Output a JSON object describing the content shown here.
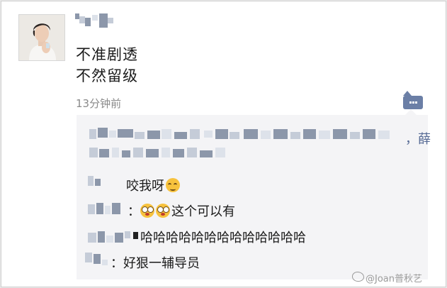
{
  "post": {
    "lines": [
      "不准剧透",
      "不然留级"
    ],
    "timestamp": "13分钟前"
  },
  "comments": {
    "blurred_author_tail": "，薛",
    "items": [
      {
        "text": "咬我呀",
        "emoji": "blush-smile-emoji"
      },
      {
        "prefix": "：",
        "emojis": [
          "shocked-face-emoji",
          "shocked-face-emoji"
        ],
        "text": "这个可以有"
      },
      {
        "text": "哈哈哈哈哈哈哈哈哈哈哈哈哈"
      },
      {
        "prefix": "：",
        "text": "好狠一辅导员"
      }
    ]
  },
  "watermark": {
    "text": "@Joan普秋艺"
  },
  "icons": {
    "comment": "comment-icon",
    "weibo": "weibo-icon"
  },
  "colors": {
    "link_blue": "#576b95",
    "comment_button": "#6b7fa6",
    "panel_bg": "#f4f4f6"
  }
}
